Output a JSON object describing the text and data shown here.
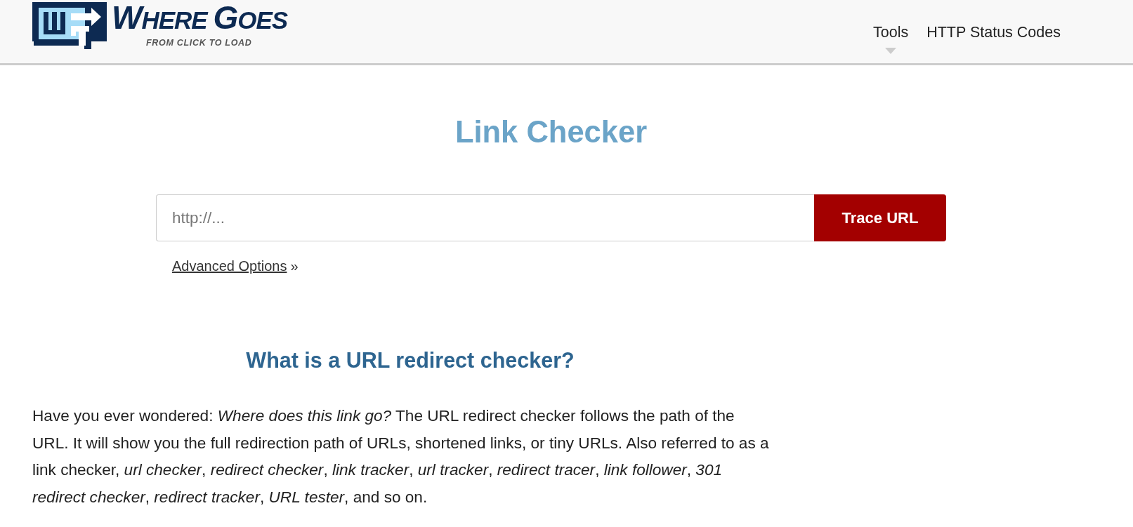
{
  "header": {
    "logo": {
      "wordmark": "WHERE GOES",
      "tagline": "FROM CLICK TO LOAD"
    },
    "nav": [
      {
        "label": "Tools",
        "kind": "dropdown"
      },
      {
        "label": "HTTP Status Codes",
        "kind": "link"
      }
    ]
  },
  "search": {
    "title": "Link Checker",
    "placeholder": "http://...",
    "button": "Trace URL",
    "advanced_options": {
      "label": "Advanced Options",
      "arrow": "»"
    }
  },
  "about": {
    "heading": "What is a URL redirect checker?",
    "paragraph": "Have you ever wondered: *Where does this link go?* The URL redirect checker follows the path of the URL. It will show you the full redirection path of URLs, shortened links, or tiny URLs. Also referred to as a link checker, *url checker*, *redirect checker*, *link tracker*, *url tracker*, *redirect tracer*, *link follower*, *301 redirect checker*, *redirect tracker*, *URL tester*, and so on."
  }
}
